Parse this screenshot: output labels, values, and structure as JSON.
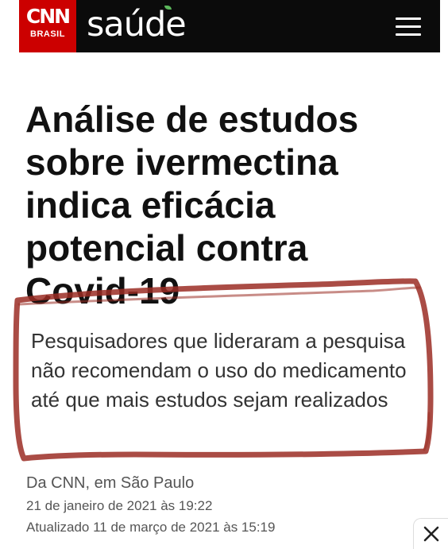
{
  "header": {
    "brand_mark": "CNN",
    "brand_sub": "BRASIL",
    "section": "saúde",
    "menu_icon": "hamburger-menu-icon",
    "background_color": "#0b0b0b",
    "brand_color": "#cc0000"
  },
  "article": {
    "headline": "Análise de estudos sobre ivermectina indica eficácia potencial contra Covid-19",
    "subheadline": "Pesquisadores que lideraram a pesquisa não recomendam o uso do medicamento até que mais estudos sejam realizados",
    "byline": "Da CNN, em São Paulo",
    "published": "21 de janeiro de 2021 às 19:22",
    "updated": "Atualizado 11 de março de 2021 às 15:19"
  },
  "overlay": {
    "annotation_color": "#9b2d24",
    "close_icon": "close-icon"
  }
}
